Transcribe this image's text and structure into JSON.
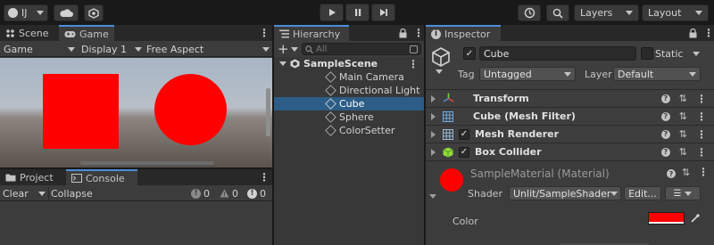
{
  "toolbar": {
    "account_label": "IJ",
    "layers_label": "Layers",
    "layout_label": "Layout"
  },
  "scene_panel": {
    "tabs": [
      {
        "label": "Scene"
      },
      {
        "label": "Game"
      }
    ],
    "game_dropdown": "Game",
    "display_dropdown": "Display 1",
    "aspect_dropdown": "Free Aspect"
  },
  "console_panel": {
    "tabs": [
      {
        "label": "Project"
      },
      {
        "label": "Console"
      }
    ],
    "clear_label": "Clear",
    "collapse_label": "Collapse",
    "info_count": "0",
    "warn_count": "0",
    "error_count": "0"
  },
  "hierarchy": {
    "title": "Hierarchy",
    "search_placeholder": "All",
    "scene_name": "SampleScene",
    "items": [
      {
        "label": "Main Camera"
      },
      {
        "label": "Directional Light"
      },
      {
        "label": "Cube"
      },
      {
        "label": "Sphere"
      },
      {
        "label": "ColorSetter"
      }
    ],
    "selected_index": 2
  },
  "inspector": {
    "title": "Inspector",
    "object_name": "Cube",
    "static_label": "Static",
    "tag_label": "Tag",
    "tag_value": "Untagged",
    "layer_label": "Layer",
    "layer_value": "Default",
    "components": [
      {
        "label": "Transform"
      },
      {
        "label": "Cube (Mesh Filter)"
      },
      {
        "label": "Mesh Renderer"
      },
      {
        "label": "Box Collider"
      }
    ],
    "material_title": "SampleMaterial (Material)",
    "shader_label": "Shader",
    "shader_value": "Unlit/SampleShader",
    "edit_label": "Edit...",
    "color_label": "Color"
  },
  "colors": {
    "accent": "#4b8eda",
    "selection": "#2c5d87",
    "object_red": "#ff0000"
  }
}
